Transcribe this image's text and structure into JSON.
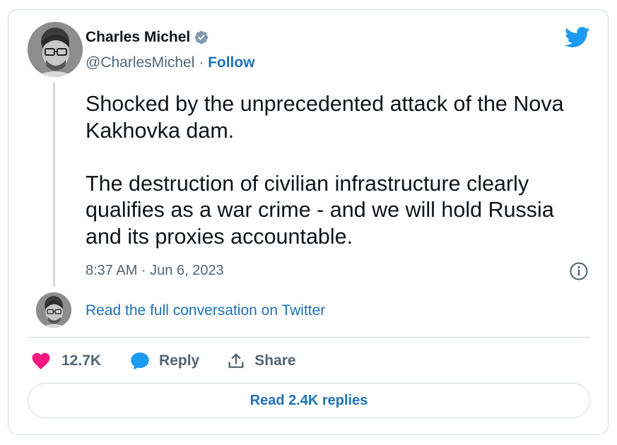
{
  "author": {
    "name": "Charles Michel",
    "handle": "@CharlesMichel",
    "separator": "·",
    "follow_label": "Follow"
  },
  "tweet": {
    "paragraphs": [
      "Shocked by the unprecedented attack of the Nova Kakhovka dam.",
      "The destruction of civilian infrastructure clearly qualifies as a war crime - and we will hold Russia and its proxies accountable."
    ],
    "timestamp": "8:37 AM · Jun 6, 2023"
  },
  "conversation": {
    "link_label": "Read the full conversation on Twitter"
  },
  "actions": {
    "like_count": "12.7K",
    "reply_label": "Reply",
    "share_label": "Share"
  },
  "replies_button": {
    "label": "Read 2.4K replies"
  },
  "icons": {
    "verified": "verified-badge-icon",
    "brand": "twitter-bird-icon",
    "info": "info-icon",
    "like": "heart-icon",
    "reply": "speech-bubble-icon",
    "share": "share-upload-icon"
  },
  "colors": {
    "brand_blue": "#1d9bf0",
    "link_blue": "#1d71b8",
    "like_pink": "#f91880",
    "text_primary": "#0f1419",
    "text_secondary": "#536471",
    "border": "#cfd9de"
  }
}
